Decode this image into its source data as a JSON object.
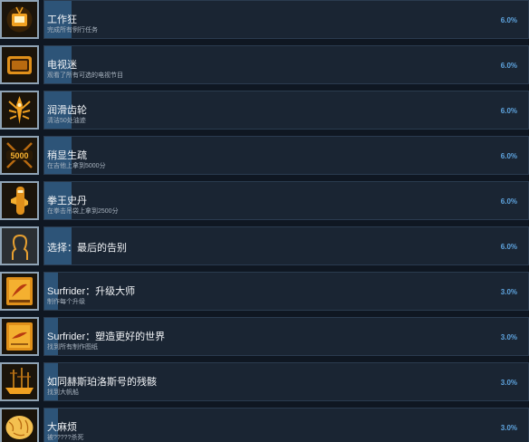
{
  "achievements": [
    {
      "title": "工作狂",
      "desc": "完成所有例行任务",
      "percent": "6.0%",
      "progress": 0.06,
      "icon": "workaholic-icon"
    },
    {
      "title": "电视迷",
      "desc": "观看了所有可选的电视节目",
      "percent": "6.0%",
      "progress": 0.06,
      "icon": "tv-icon"
    },
    {
      "title": "润滑齿轮",
      "desc": "清洁50处油迹",
      "percent": "6.0%",
      "progress": 0.06,
      "icon": "gear-oil-icon"
    },
    {
      "title": "稍显生疏",
      "desc": "在吉他上拿到5000分",
      "percent": "6.0%",
      "progress": 0.06,
      "icon": "guitar-5000-icon"
    },
    {
      "title": "拳王史丹",
      "desc": "在拳击吊袋上拿到2500分",
      "percent": "6.0%",
      "progress": 0.06,
      "icon": "punching-bag-icon"
    },
    {
      "title": "选择：最后的告别",
      "desc": "",
      "percent": "6.0%",
      "progress": 0.06,
      "icon": "silhouette-icon"
    },
    {
      "title": "Surfrider：升级大师",
      "desc": "制作每个升级",
      "percent": "3.0%",
      "progress": 0.03,
      "icon": "surfboard-upgrade-icon"
    },
    {
      "title": "Surfrider：塑造更好的世界",
      "desc": "找到所有制作图纸",
      "percent": "3.0%",
      "progress": 0.03,
      "icon": "surfboard-blueprint-icon"
    },
    {
      "title": "如同赫斯珀洛斯号的残骸",
      "desc": "找到大帆船",
      "percent": "3.0%",
      "progress": 0.03,
      "icon": "galleon-icon"
    },
    {
      "title": "大麻烦",
      "desc": "被?????杀死",
      "percent": "3.0%",
      "progress": 0.03,
      "icon": "scales-icon"
    }
  ]
}
